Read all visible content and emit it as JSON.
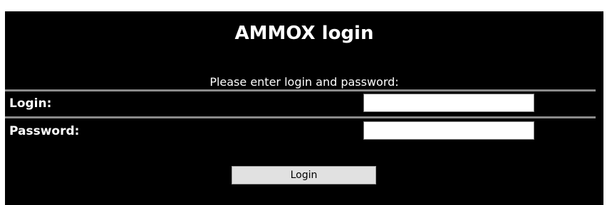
{
  "form": {
    "title": "AMMOX login",
    "prompt": "Please enter login and password:",
    "login_label": "Login:",
    "login_value": "",
    "password_label": "Password:",
    "password_value": "",
    "submit_label": "Login"
  },
  "colors": {
    "panel_background": "#000000",
    "text": "#ffffff",
    "divider": "#8a8a8a",
    "input_background": "#ffffff",
    "button_background": "#e1e1e1"
  }
}
